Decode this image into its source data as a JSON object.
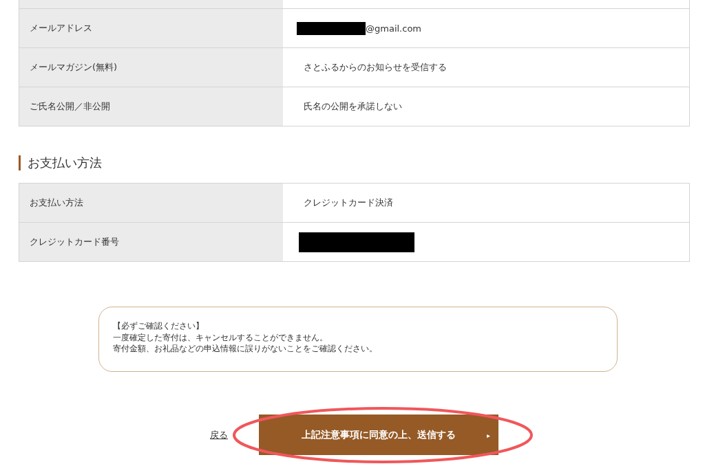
{
  "top_table": {
    "rows": [
      {
        "kind": "partial"
      },
      {
        "kind": "redacted_prefix",
        "label": "メールアドレス",
        "value": "@gmail.com"
      },
      {
        "kind": "text",
        "label": "メールマガジン(無料)",
        "value": "さとふるからのお知らせを受信する"
      },
      {
        "kind": "text",
        "label": "ご氏名公開／非公開",
        "value": "氏名の公開を承諾しない"
      }
    ]
  },
  "payment": {
    "heading": "お支払い方法",
    "rows": [
      {
        "kind": "text",
        "label": "お支払い方法",
        "value": "クレジットカード決済"
      },
      {
        "kind": "redacted",
        "label": "クレジットカード番号"
      }
    ]
  },
  "notice": {
    "lines": [
      "【必ずご確認ください】",
      "一度確定した寄付は、キャンセルすることができません。",
      "寄付金額、お礼品などの申込情報に誤りがないことをご確認ください。"
    ]
  },
  "actions": {
    "back_link": "戻る",
    "submit_button": "上記注意事項に同意の上、送信する",
    "submit_arrow": "▸",
    "highlight_annotation": true
  }
}
